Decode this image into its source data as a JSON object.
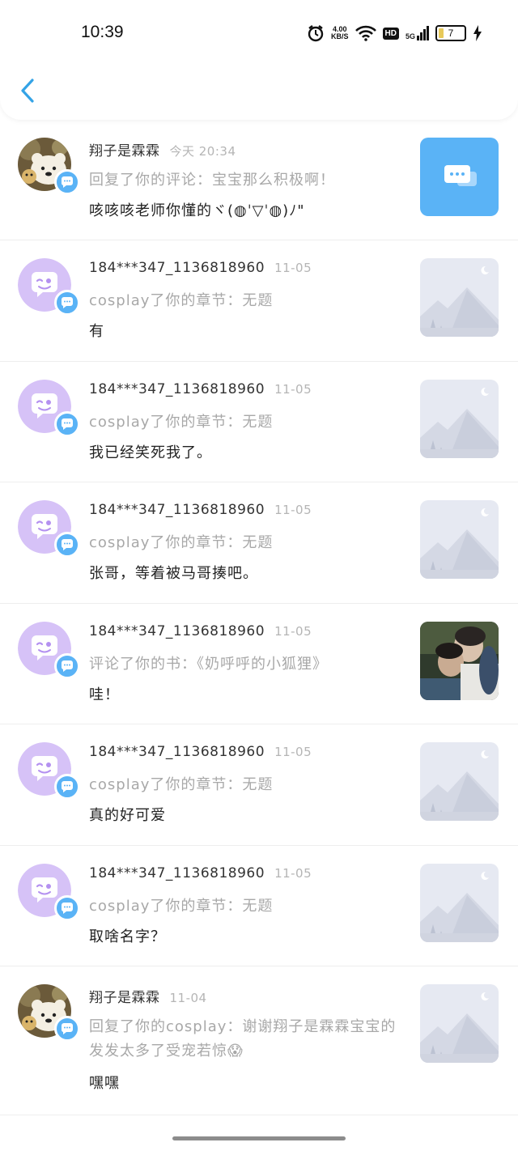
{
  "status": {
    "time": "10:39",
    "net_speed": "4.00",
    "net_unit": "KB/S",
    "hd": "HD",
    "signal": "5G",
    "battery": "7"
  },
  "header": {
    "back_icon": "chevron-left-icon"
  },
  "colors": {
    "accent": "#34a3e6",
    "badge": "#5ab3f6",
    "thumb_blue": "#5ab3f6",
    "avatar_purple": "#d6c2f7"
  },
  "items": [
    {
      "name": "翔子是霖霖",
      "time": "今天 20:34",
      "sub": "回复了你的评论：宝宝那么积极啊！",
      "msg": "咳咳咳老师你懂的ヾ(◍ˈ▽ˈ◍)ﾉ\"",
      "avatar": "bear",
      "thumb": "chat"
    },
    {
      "name": "184***347_1136818960",
      "time": "11-05",
      "sub": "cosplay了你的章节：无题",
      "msg": "有",
      "avatar": "purple",
      "thumb": "placeholder"
    },
    {
      "name": "184***347_1136818960",
      "time": "11-05",
      "sub": "cosplay了你的章节：无题",
      "msg": "我已经笑死我了。",
      "avatar": "purple",
      "thumb": "placeholder"
    },
    {
      "name": "184***347_1136818960",
      "time": "11-05",
      "sub": "cosplay了你的章节：无题",
      "msg": "张哥，等着被马哥揍吧。",
      "avatar": "purple",
      "thumb": "placeholder"
    },
    {
      "name": "184***347_1136818960",
      "time": "11-05",
      "sub": "评论了你的书：《奶呼呼的小狐狸》",
      "msg": "哇！",
      "avatar": "purple",
      "thumb": "photo"
    },
    {
      "name": "184***347_1136818960",
      "time": "11-05",
      "sub": "cosplay了你的章节：无题",
      "msg": "真的好可爱",
      "avatar": "purple",
      "thumb": "placeholder"
    },
    {
      "name": "184***347_1136818960",
      "time": "11-05",
      "sub": "cosplay了你的章节：无题",
      "msg": "取啥名字？",
      "avatar": "purple",
      "thumb": "placeholder"
    },
    {
      "name": "翔子是霖霖",
      "time": "11-04",
      "sub": "回复了你的cosplay：谢谢翔子是霖霖宝宝的发发太多了受宠若惊😱",
      "msg": "嘿嘿",
      "avatar": "bear",
      "thumb": "placeholder"
    }
  ]
}
